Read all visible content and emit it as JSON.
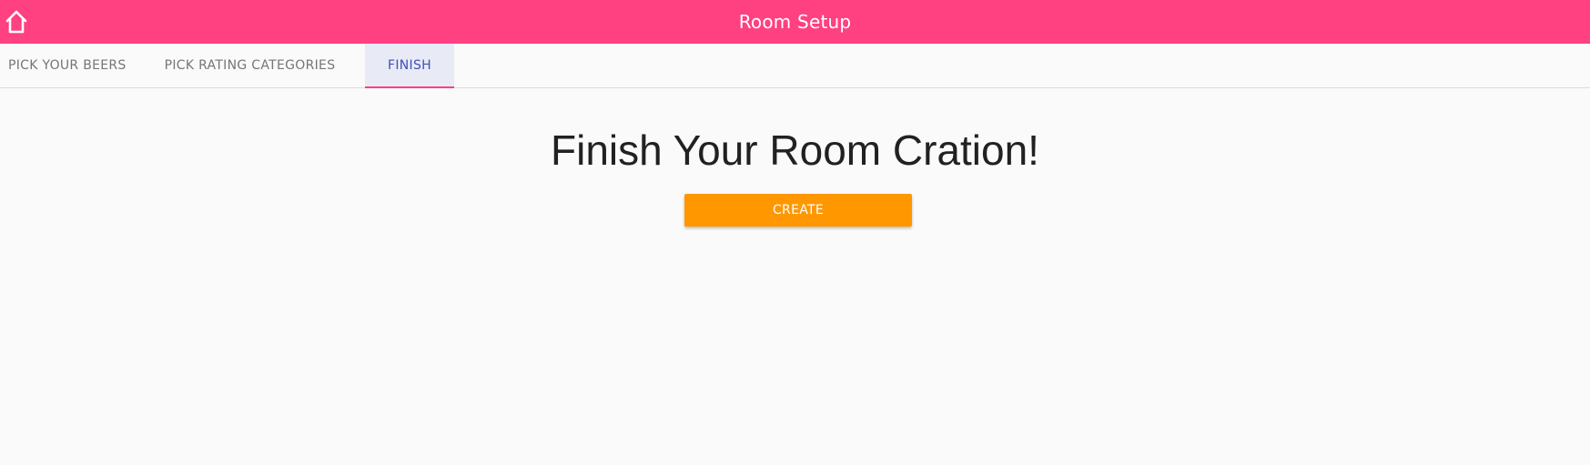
{
  "app_bar": {
    "title": "Room Setup",
    "background_color": "#ff4081",
    "home_icon": "home-icon"
  },
  "tabs": [
    {
      "label": "PICK YOUR BEERS",
      "selected": false
    },
    {
      "label": "PICK RATING CATEGORIES",
      "selected": false
    },
    {
      "label": "FINISH",
      "selected": true
    }
  ],
  "main": {
    "heading": "Finish Your Room Cration!",
    "create_button_label": "CREATE",
    "create_button_color": "#ff9800"
  }
}
